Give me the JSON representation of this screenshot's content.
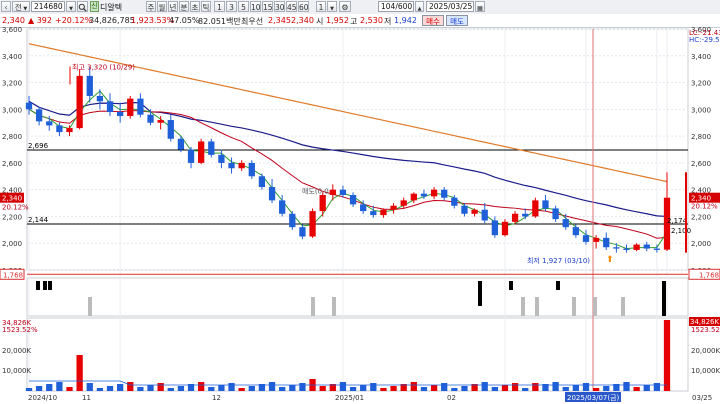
{
  "toolbar": {
    "nav_prev": "‹",
    "market_label": "전",
    "code": "214680",
    "search_icon": "magnifier-icon",
    "badge": "신",
    "stock_name": "디알텍",
    "periods": [
      "주",
      "월",
      "년",
      "분",
      "초",
      "틱"
    ],
    "intervals": [
      "1",
      "3",
      "5",
      "10",
      "15",
      "30",
      "45",
      "60"
    ],
    "more": "1",
    "count": "104/600",
    "date": "2025/03/25"
  },
  "quote": {
    "price": "2,340",
    "change": "▲ 392",
    "change_rate": "+20.12%",
    "volume": "34,826,785",
    "volume_rate": "1,923.53%",
    "exhaustion": "47.05%",
    "amount": "82.051백만",
    "priority": "최우선",
    "ask": "2,345",
    "bid": "2,340",
    "open_label": "시",
    "open": "1,952",
    "high_label": "고",
    "high": "2,530",
    "low_label": "저",
    "low": "1,942",
    "buy_label": "매수",
    "sell_label": "매도"
  },
  "colors": {
    "up": "#e60000",
    "down": "#1f5fd8",
    "ma5": "#2e9d2e",
    "ma20": "#c0001a",
    "ma60": "#1c1c8c",
    "ma120": "#e07a28",
    "volume_ma": "#1f5fd8",
    "panel_border": "#c8ccd4"
  },
  "chart_data": {
    "type": "candlestick",
    "symbol": "214680",
    "name": "디알텍",
    "y_axis": [
      "3,600",
      "3,400",
      "3,200",
      "3,000",
      "2,800",
      "2,600",
      "2,400",
      "2,200",
      "2,000",
      "1,800"
    ],
    "ylim": [
      1800,
      3600
    ],
    "x_ticks": [
      "2024/10",
      "11",
      "12",
      "2025/01",
      "02",
      "2025/03/07(금)",
      "03/25"
    ],
    "horizontal_lines": [
      {
        "label": "2,696",
        "value": 2696
      },
      {
        "label": "2,144",
        "value": 2144
      }
    ],
    "annotations": [
      {
        "text": "최고 3,320 (10/29)",
        "value": 3320
      },
      {
        "text": "최저 1,927 (03/10)",
        "value": 1927
      },
      {
        "text": "매도(0.0",
        "value": 2370
      }
    ],
    "right_labels": {
      "lc": "LC:-21.43",
      "hc": "HC:-29.52",
      "current": "2,340",
      "current_rate": "20.12%",
      "ma_a": "2,174",
      "ma_b": "2,100",
      "low_line": "1,768"
    },
    "left_labels": {
      "current": "2,340",
      "rate": "20.12%",
      "low_line": "1,768"
    },
    "candles": [
      [
        3050,
        3100,
        2960,
        3000
      ],
      [
        3000,
        3020,
        2880,
        2910
      ],
      [
        2910,
        2950,
        2840,
        2880
      ],
      [
        2880,
        2900,
        2800,
        2830
      ],
      [
        2830,
        2880,
        2800,
        2860
      ],
      [
        2860,
        3300,
        2850,
        3250
      ],
      [
        3250,
        3320,
        3050,
        3100
      ],
      [
        3100,
        3150,
        3000,
        3060
      ],
      [
        3060,
        3120,
        2950,
        2980
      ],
      [
        2980,
        3050,
        2900,
        2950
      ],
      [
        2950,
        3100,
        2930,
        3080
      ],
      [
        3080,
        3120,
        2940,
        2960
      ],
      [
        2960,
        3000,
        2880,
        2900
      ],
      [
        2900,
        2950,
        2850,
        2920
      ],
      [
        2920,
        2960,
        2760,
        2780
      ],
      [
        2780,
        2800,
        2680,
        2700
      ],
      [
        2700,
        2720,
        2560,
        2600
      ],
      [
        2600,
        2780,
        2590,
        2760
      ],
      [
        2760,
        2780,
        2640,
        2660
      ],
      [
        2660,
        2700,
        2560,
        2600
      ],
      [
        2600,
        2640,
        2520,
        2560
      ],
      [
        2560,
        2620,
        2540,
        2600
      ],
      [
        2600,
        2620,
        2480,
        2500
      ],
      [
        2500,
        2520,
        2400,
        2420
      ],
      [
        2420,
        2480,
        2300,
        2320
      ],
      [
        2320,
        2360,
        2200,
        2220
      ],
      [
        2220,
        2240,
        2100,
        2120
      ],
      [
        2120,
        2140,
        2030,
        2050
      ],
      [
        2050,
        2260,
        2040,
        2240
      ],
      [
        2240,
        2380,
        2200,
        2360
      ],
      [
        2360,
        2440,
        2320,
        2400
      ],
      [
        2400,
        2430,
        2340,
        2360
      ],
      [
        2360,
        2380,
        2270,
        2290
      ],
      [
        2290,
        2320,
        2220,
        2240
      ],
      [
        2240,
        2280,
        2190,
        2210
      ],
      [
        2210,
        2260,
        2190,
        2250
      ],
      [
        2250,
        2300,
        2220,
        2280
      ],
      [
        2280,
        2340,
        2260,
        2320
      ],
      [
        2320,
        2380,
        2300,
        2370
      ],
      [
        2370,
        2400,
        2330,
        2350
      ],
      [
        2350,
        2420,
        2330,
        2400
      ],
      [
        2400,
        2420,
        2320,
        2340
      ],
      [
        2340,
        2360,
        2260,
        2280
      ],
      [
        2280,
        2300,
        2200,
        2220
      ],
      [
        2220,
        2260,
        2200,
        2250
      ],
      [
        2250,
        2300,
        2150,
        2170
      ],
      [
        2170,
        2200,
        2040,
        2060
      ],
      [
        2060,
        2180,
        2050,
        2160
      ],
      [
        2160,
        2240,
        2140,
        2220
      ],
      [
        2220,
        2260,
        2180,
        2200
      ],
      [
        2200,
        2340,
        2190,
        2320
      ],
      [
        2320,
        2360,
        2240,
        2260
      ],
      [
        2260,
        2280,
        2160,
        2180
      ],
      [
        2180,
        2220,
        2100,
        2120
      ],
      [
        2120,
        2140,
        2040,
        2060
      ],
      [
        2060,
        2100,
        1990,
        2010
      ],
      [
        2010,
        2060,
        1960,
        2040
      ],
      [
        2040,
        2080,
        1950,
        1970
      ],
      [
        1970,
        2000,
        1930,
        1960
      ],
      [
        1960,
        1990,
        1930,
        1950
      ],
      [
        1950,
        2000,
        1940,
        1990
      ],
      [
        1990,
        2010,
        1940,
        1960
      ],
      [
        1960,
        1990,
        1930,
        1950
      ],
      [
        1952,
        2530,
        1942,
        2340
      ]
    ],
    "volume_axis": [
      "34,826K",
      "1523.52%",
      "20,000K",
      "10,000K"
    ],
    "volume_spike_label": "34,826K"
  }
}
